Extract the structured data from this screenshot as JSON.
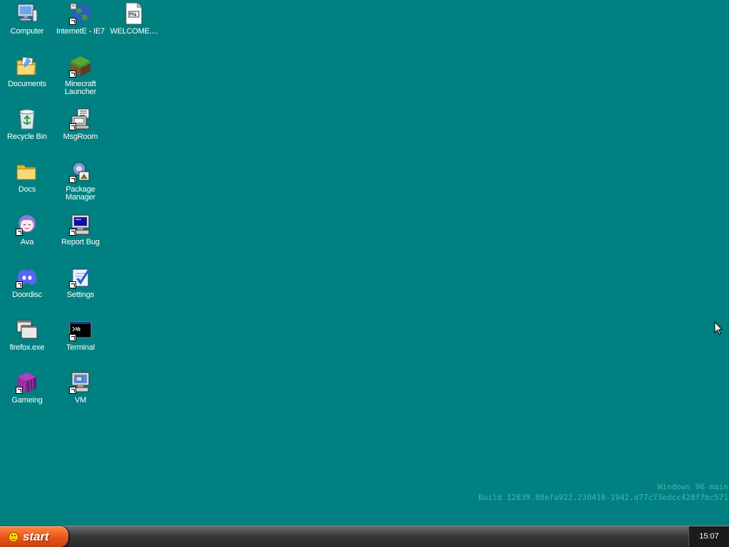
{
  "desktop": {
    "background": "#008080",
    "icons": [
      {
        "label": "Computer",
        "icon": "computer-icon",
        "shortcut": false
      },
      {
        "label": "InternetE - IE7",
        "icon": "internet-explorer-icon",
        "shortcut": true
      },
      {
        "label": "WELCOME....",
        "icon": "markdown-file-icon",
        "shortcut": false
      },
      {
        "label": "Documents",
        "icon": "documents-folder-icon",
        "shortcut": false
      },
      {
        "label": "Minecraft Launcher",
        "icon": "minecraft-icon",
        "shortcut": true
      },
      {
        "label": "Recycle Bin",
        "icon": "recycle-bin-icon",
        "shortcut": false
      },
      {
        "label": "MsgRoom",
        "icon": "msgroom-icon",
        "shortcut": true
      },
      {
        "label": "Docs",
        "icon": "folder-icon",
        "shortcut": false
      },
      {
        "label": "Package Manager",
        "icon": "package-manager-icon",
        "shortcut": true
      },
      {
        "label": "Ava",
        "icon": "ava-icon",
        "shortcut": true
      },
      {
        "label": "Report Bug",
        "icon": "report-bug-icon",
        "shortcut": true
      },
      {
        "label": "Doordisc",
        "icon": "discord-icon",
        "shortcut": true
      },
      {
        "label": "Settings",
        "icon": "settings-icon",
        "shortcut": true
      },
      {
        "label": "firefox.exe",
        "icon": "window-icon",
        "shortcut": false
      },
      {
        "label": "Terminal",
        "icon": "terminal-icon",
        "shortcut": true
      },
      {
        "label": "Gameing",
        "icon": "cube-icon",
        "shortcut": true
      },
      {
        "label": "VM",
        "icon": "vm-icon",
        "shortcut": true
      }
    ],
    "watermark": {
      "line1": "Windows 96 main",
      "line2": "Build 12839.88efa922.230410-1942.d77c73edcc428f7bc571"
    }
  },
  "taskbar": {
    "start_label": "start",
    "clock": "15:07"
  },
  "colors": {
    "desktop_bg": "#008080",
    "start_orange": "#e8541a",
    "taskbar_dark": "#2b2b2b"
  }
}
